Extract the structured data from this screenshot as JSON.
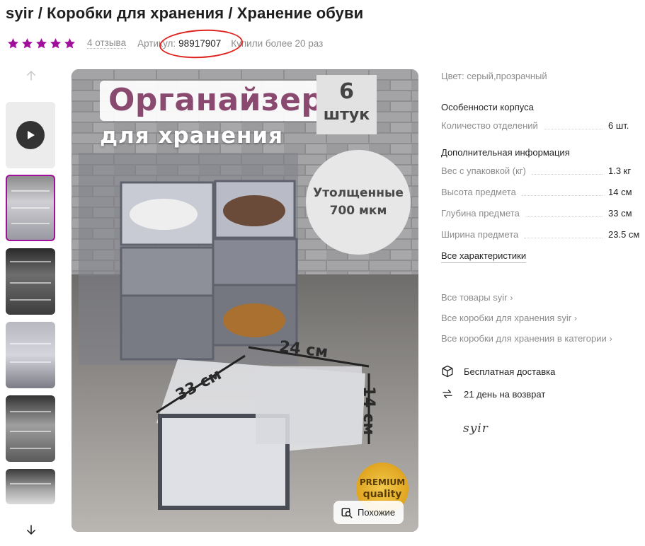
{
  "header": {
    "title": "syir / Коробки для хранения / Хранение обуви"
  },
  "meta": {
    "rating_stars": 5,
    "star_color": "#a30f9d",
    "reviews": "4 отзыва",
    "article_label": "Артикул:",
    "article_value": "98917907",
    "bought": "Купили более 20 раз",
    "annotation_color": "#e0231f"
  },
  "gallery": {
    "up_icon": "arrow-up-icon",
    "down_icon": "arrow-down-icon",
    "play_icon": "play-icon",
    "thumbnails_count": 5,
    "active_thumbnail": 1
  },
  "image": {
    "headline": "Органайзер",
    "subheadline": "для хранения",
    "count_number": "6",
    "count_unit": "штук",
    "thick_line1": "Утолщенные",
    "thick_line2": "700 мкм",
    "dim_width": "24 см",
    "dim_depth": "33 см",
    "dim_height": "14 см",
    "premium_top": "PREMIUM",
    "premium_bottom": "quality",
    "similar_button": "Похожие"
  },
  "specs": {
    "color_label": "Цвет:",
    "color_value": "серый,прозрачный",
    "case_heading": "Особенности корпуса",
    "case_rows": [
      {
        "k": "Количество отделений",
        "v": "6 шт."
      }
    ],
    "extra_heading": "Дополнительная информация",
    "extra_rows": [
      {
        "k": "Вес с упаковкой (кг)",
        "v": "1.3 кг"
      },
      {
        "k": "Высота предмета",
        "v": "14 см"
      },
      {
        "k": "Глубина предмета",
        "v": "33 см"
      },
      {
        "k": "Ширина предмета",
        "v": "23.5 см"
      }
    ],
    "all_characteristics": "Все характеристики"
  },
  "links": [
    "Все товары syir",
    "Все коробки для хранения syir",
    "Все коробки для хранения в категории"
  ],
  "features": {
    "delivery": "Бесплатная доставка",
    "returns": "21 день на возврат"
  },
  "brand": {
    "logo_text": "syir"
  }
}
